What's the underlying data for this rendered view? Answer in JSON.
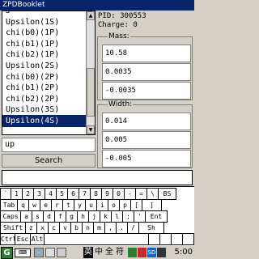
{
  "window": {
    "title": "ZPDBooklet"
  },
  "particle_list": {
    "items": [
      "J",
      "Upsilon(1S)",
      "chi(b0)(1P)",
      "chi(b1)(1P)",
      "chi(b2)(1P)",
      "Upsilon(2S)",
      "chi(b0)(2P)",
      "chi(b1)(2P)",
      "chi(b2)(2P)",
      "Upsilon(3S)",
      "Upsilon(4S)"
    ],
    "selected_index": 10
  },
  "search": {
    "value": "up",
    "button_label": "Search"
  },
  "particle": {
    "pid_label": "PID:",
    "pid": "300553",
    "charge_label": "Charge:",
    "charge": "0",
    "mass": {
      "label": "Mass:",
      "value": "10.58",
      "error_plus": "0.0035",
      "error_minus": "-0.0035"
    },
    "width": {
      "label": "Width:",
      "value": "0.014",
      "error_plus": "0.005",
      "error_minus": "-0.005"
    }
  },
  "keyboard": {
    "row1": [
      "`",
      "1",
      "2",
      "3",
      "4",
      "5",
      "6",
      "7",
      "8",
      "9",
      "0",
      "-",
      "=",
      "\\",
      "BS"
    ],
    "row2": [
      "Tab",
      "q",
      "w",
      "e",
      "r",
      "t",
      "y",
      "u",
      "i",
      "o",
      "p",
      "[",
      "]"
    ],
    "row3": [
      "Caps",
      "a",
      "s",
      "d",
      "f",
      "g",
      "h",
      "j",
      "k",
      "l",
      ";",
      "'",
      "Ent"
    ],
    "row4": [
      "Shift",
      "z",
      "x",
      "c",
      "v",
      "b",
      "n",
      "m",
      ",",
      ".",
      "/",
      "Sh"
    ],
    "row5": [
      "Ctrl",
      "Esc",
      "Alt",
      "",
      "",
      "",
      "",
      ""
    ]
  },
  "taskbar": {
    "ime": [
      "英",
      "中",
      "全",
      "符"
    ],
    "clock": "5:00",
    "colors": {
      "start": "#2e7d32",
      "selection": "#0a246a"
    }
  }
}
